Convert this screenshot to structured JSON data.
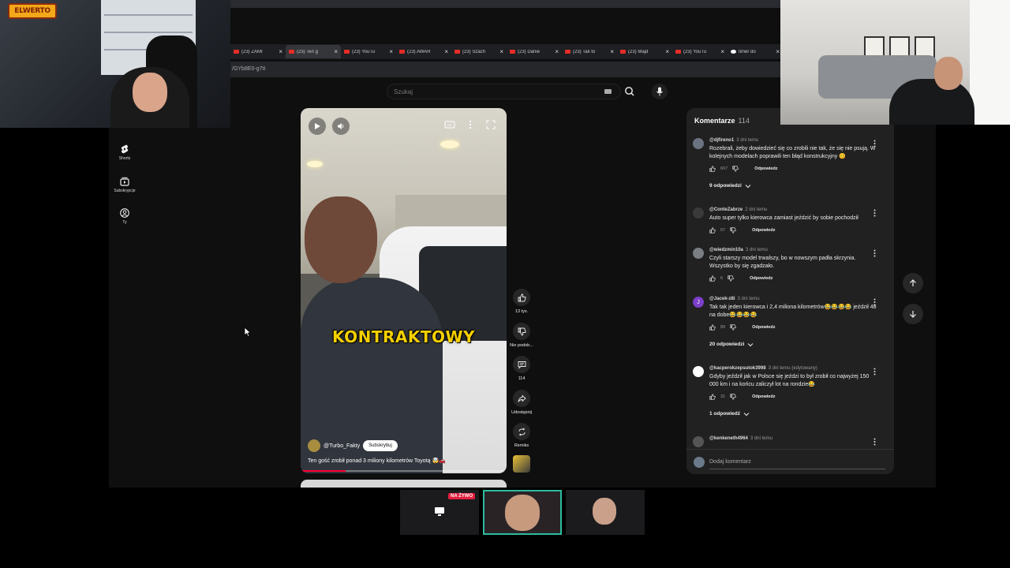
{
  "browser": {
    "tabs": [
      {
        "label": "(23) ZAMI",
        "favicon": "youtube-icon",
        "active": false
      },
      {
        "label": "(23) Ten g",
        "favicon": "youtube-icon",
        "active": true
      },
      {
        "label": "(23) YouTu",
        "favicon": "youtube-icon",
        "active": false
      },
      {
        "label": "(23) AWAR",
        "favicon": "youtube-icon",
        "active": false
      },
      {
        "label": "(23) Szach",
        "favicon": "youtube-icon",
        "active": false
      },
      {
        "label": "(23) Danie",
        "favicon": "youtube-icon",
        "active": false
      },
      {
        "label": "(23) Tak to",
        "favicon": "youtube-icon",
        "active": false
      },
      {
        "label": "(23) Majd",
        "favicon": "youtube-icon",
        "active": false
      },
      {
        "label": "(23) YouTu",
        "favicon": "youtube-icon",
        "active": false
      },
      {
        "label": "timer do",
        "favicon": "google-icon",
        "active": false
      }
    ],
    "close_glyph": "×",
    "url": "/GYb8E0-g7tI"
  },
  "youtube": {
    "search_placeholder": "Szukaj",
    "nav": [
      {
        "label": "Shorts",
        "icon": "shorts-icon"
      },
      {
        "label": "Subskrypcje",
        "icon": "subscriptions-icon"
      },
      {
        "label": "Ty",
        "icon": "profile-icon"
      }
    ],
    "video": {
      "caption": "KONTRAKTOWY",
      "channel": "@Turbo_Fakty",
      "subscribe_label": "Subskrybuj",
      "title": "Ten gość zrobił ponad 3 miliony kilometrów Toyotą 🤯🚗",
      "progress": 0.22
    },
    "actions": {
      "likes": "13 tys.",
      "dislike_label": "Nie podob...",
      "comments": "114",
      "share_label": "Udostępnij",
      "remix_label": "Remiks"
    },
    "comments_panel": {
      "title": "Komentarze",
      "count": "114",
      "comments": [
        {
          "author": "@djfireno1",
          "time": "3 dni temu",
          "text": "Rozebrali, żeby dowiedzieć się co zrobili nie tak, że się nie psują. W kolejnych modelach poprawili ten błąd konstrukcyjny 😊",
          "likes": "607",
          "reply": "Odpowiedz",
          "replies": "9 odpowiedzi",
          "avatar_color": "#6b7380",
          "avatar_letter": ""
        },
        {
          "author": "@ConteZabrze",
          "time": "2 dni temu",
          "text": "Auto super tylko kierowca zamiast jeździć by sobie pochodził",
          "likes": "67",
          "reply": "Odpowiedz",
          "replies": "",
          "avatar_color": "#3a3a3a",
          "avatar_letter": ""
        },
        {
          "author": "@wiedzmin10a",
          "time": "3 dni temu",
          "text": "Czyli starszy model trwalszy, bo w nowszym padła skrzynia. Wszystko by się zgadzało.",
          "likes": "6",
          "reply": "Odpowiedz",
          "replies": "",
          "avatar_color": "#7a7d82",
          "avatar_letter": ""
        },
        {
          "author": "@Jacek-z8i",
          "time": "3 dni temu",
          "text": "Tak tak jeden kierowca i 2,4 miliona kilometrów😂😂😂😂 jeździł 48 na dobe😂😂😂😂",
          "likes": "89",
          "reply": "Odpowiedz",
          "replies": "20 odpowiedzi",
          "avatar_color": "#7b3fc9",
          "avatar_letter": "J"
        },
        {
          "author": "@kacperokzepsutok3998",
          "time": "3 dni temu (edytowany)",
          "text": "Gdyby jeździł jak w Polsce się jeździ to był zrobił co najwyżej 150 000 km i na końcu zaliczył lot na rondzie😂",
          "likes": "31",
          "reply": "Odpowiedz",
          "replies": "1 odpowiedź",
          "avatar_color": "#ffffff",
          "avatar_letter": ""
        },
        {
          "author": "@kenkeneth4964",
          "time": "3 dni temu",
          "text": "",
          "likes": "",
          "reply": "",
          "replies": "",
          "avatar_color": "#555555",
          "avatar_letter": ""
        }
      ],
      "add_placeholder": "Dodaj komentarz"
    }
  },
  "stream": {
    "logo_text": "ELWERTO",
    "live_badge": "NA ŻYWO"
  },
  "colors": {
    "accent_red": "#ff0033",
    "caption_yellow": "#f5d000",
    "active_tile_border": "#2dbb9e",
    "live_red": "#e41e3f"
  }
}
